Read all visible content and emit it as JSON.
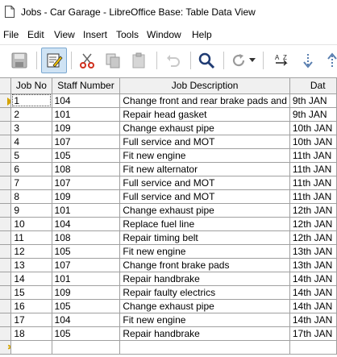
{
  "window": {
    "title": "Jobs - Car Garage - LibreOffice Base: Table Data View"
  },
  "menu": [
    "File",
    "Edit",
    "View",
    "Insert",
    "Tools",
    "Window",
    "Help"
  ],
  "toolbar": {
    "icons": [
      "save-icon",
      "edit-icon",
      "cut-icon",
      "copy-icon",
      "paste-icon",
      "undo-icon",
      "find-icon",
      "refresh-icon",
      "sort-icon",
      "sort-down-icon",
      "sort-up-icon"
    ]
  },
  "table": {
    "columns": [
      "Job No",
      "Staff Number",
      "Job Description",
      "Dat"
    ],
    "rows": [
      [
        "1",
        "104",
        "Change front and rear brake pads and",
        "9th JAN"
      ],
      [
        "2",
        "101",
        "Repair head gasket",
        "9th JAN"
      ],
      [
        "3",
        "109",
        "Change exhaust pipe",
        "10th JAN"
      ],
      [
        "4",
        "107",
        "Full service and MOT",
        "10th JAN"
      ],
      [
        "5",
        "105",
        "Fit new engine",
        "11th JAN"
      ],
      [
        "6",
        "108",
        "Fit new alternator",
        "11th JAN"
      ],
      [
        "7",
        "107",
        "Full service and MOT",
        "11th JAN"
      ],
      [
        "8",
        "109",
        "Full service and MOT",
        "11th JAN"
      ],
      [
        "9",
        "101",
        "Change exhaust pipe",
        "12th JAN"
      ],
      [
        "10",
        "104",
        "Replace fuel line",
        "12th JAN"
      ],
      [
        "11",
        "108",
        "Repair timing belt",
        "12th JAN"
      ],
      [
        "12",
        "105",
        "Fit new engine",
        "13th JAN"
      ],
      [
        "13",
        "107",
        "Change front brake pads",
        "13th JAN"
      ],
      [
        "14",
        "101",
        "Repair handbrake",
        "14th JAN"
      ],
      [
        "15",
        "109",
        "Repair faulty electrics",
        "14th JAN"
      ],
      [
        "16",
        "105",
        "Change exhaust pipe",
        "14th JAN"
      ],
      [
        "17",
        "104",
        "Fit new engine",
        "14th JAN"
      ],
      [
        "18",
        "105",
        "Repair handbrake",
        "17th JAN"
      ]
    ],
    "current_row": 0
  }
}
